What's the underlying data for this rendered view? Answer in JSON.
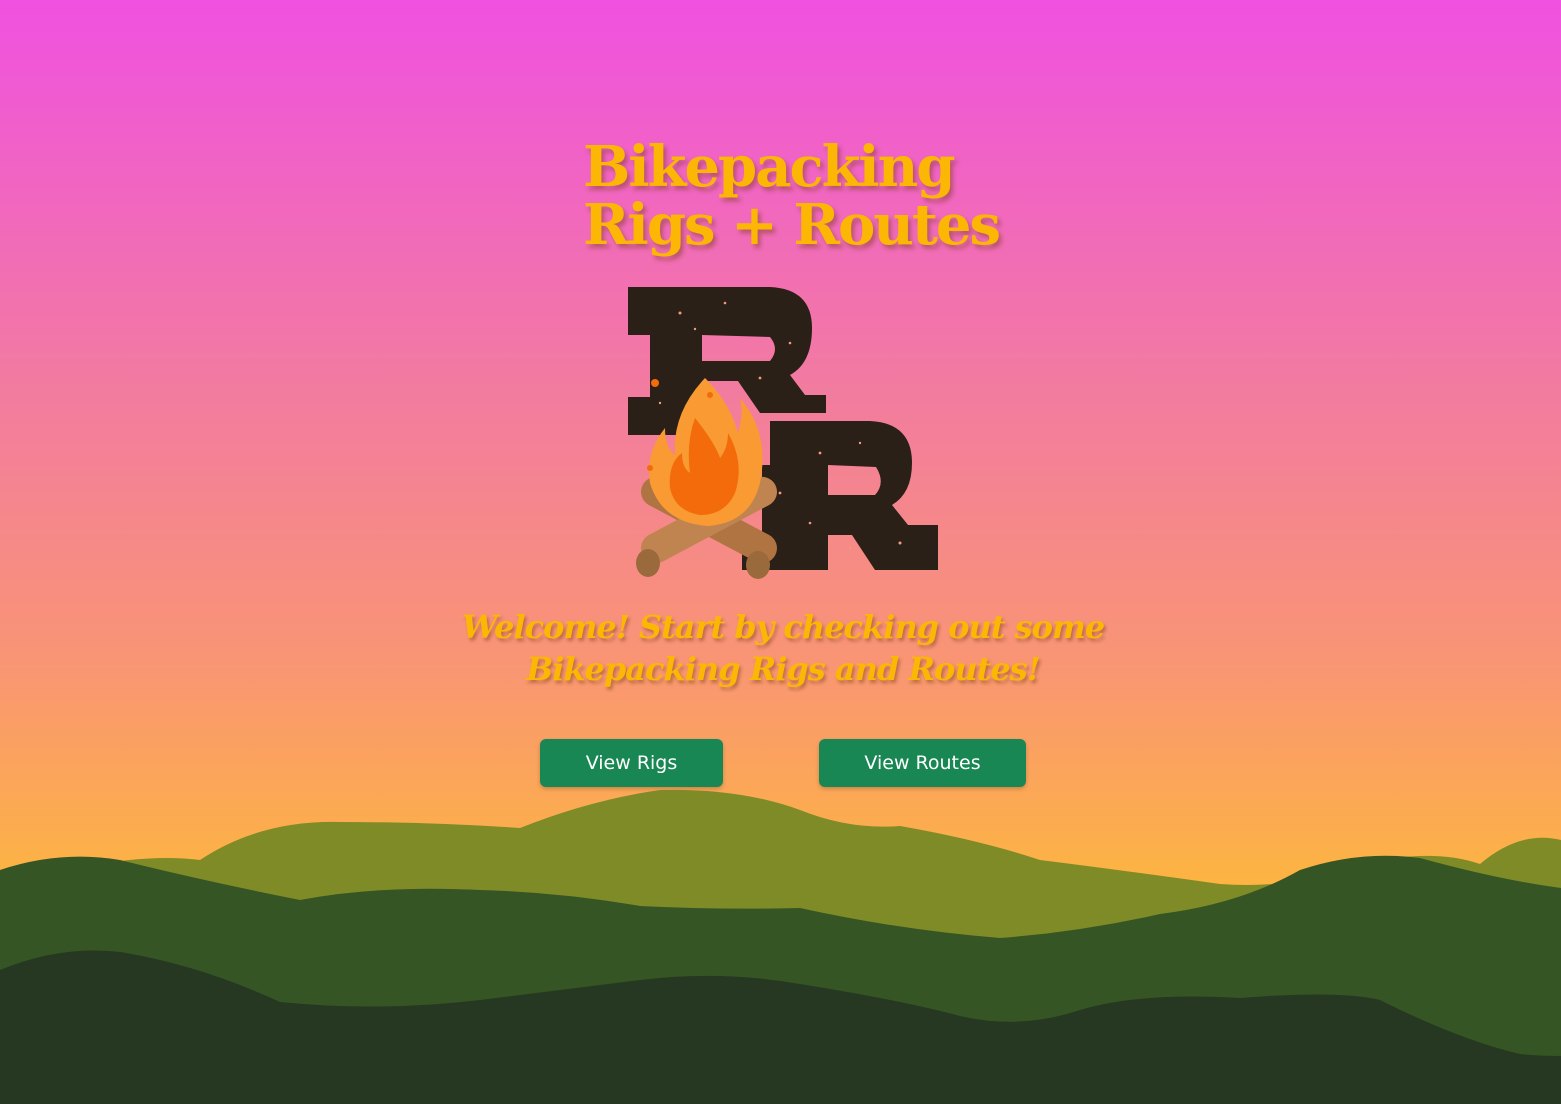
{
  "header": {
    "title_line1": "Bikepacking",
    "title_line2": "Rigs + Routes"
  },
  "logo": {
    "icon": "campfire-logo-icon",
    "letters": "RR"
  },
  "welcome": {
    "text": "Welcome! Start by checking out some Bikepacking Rigs and Routes!"
  },
  "buttons": {
    "rigs_label": "View Rigs",
    "routes_label": "View Routes"
  },
  "colors": {
    "title": "#fcb704",
    "button_bg": "#198754",
    "button_text": "#ffffff",
    "sky_top": "#f051e0",
    "sky_bottom": "#fdb442",
    "hill_back": "#7f8b27",
    "hill_mid": "#365524",
    "hill_front": "#263821"
  }
}
